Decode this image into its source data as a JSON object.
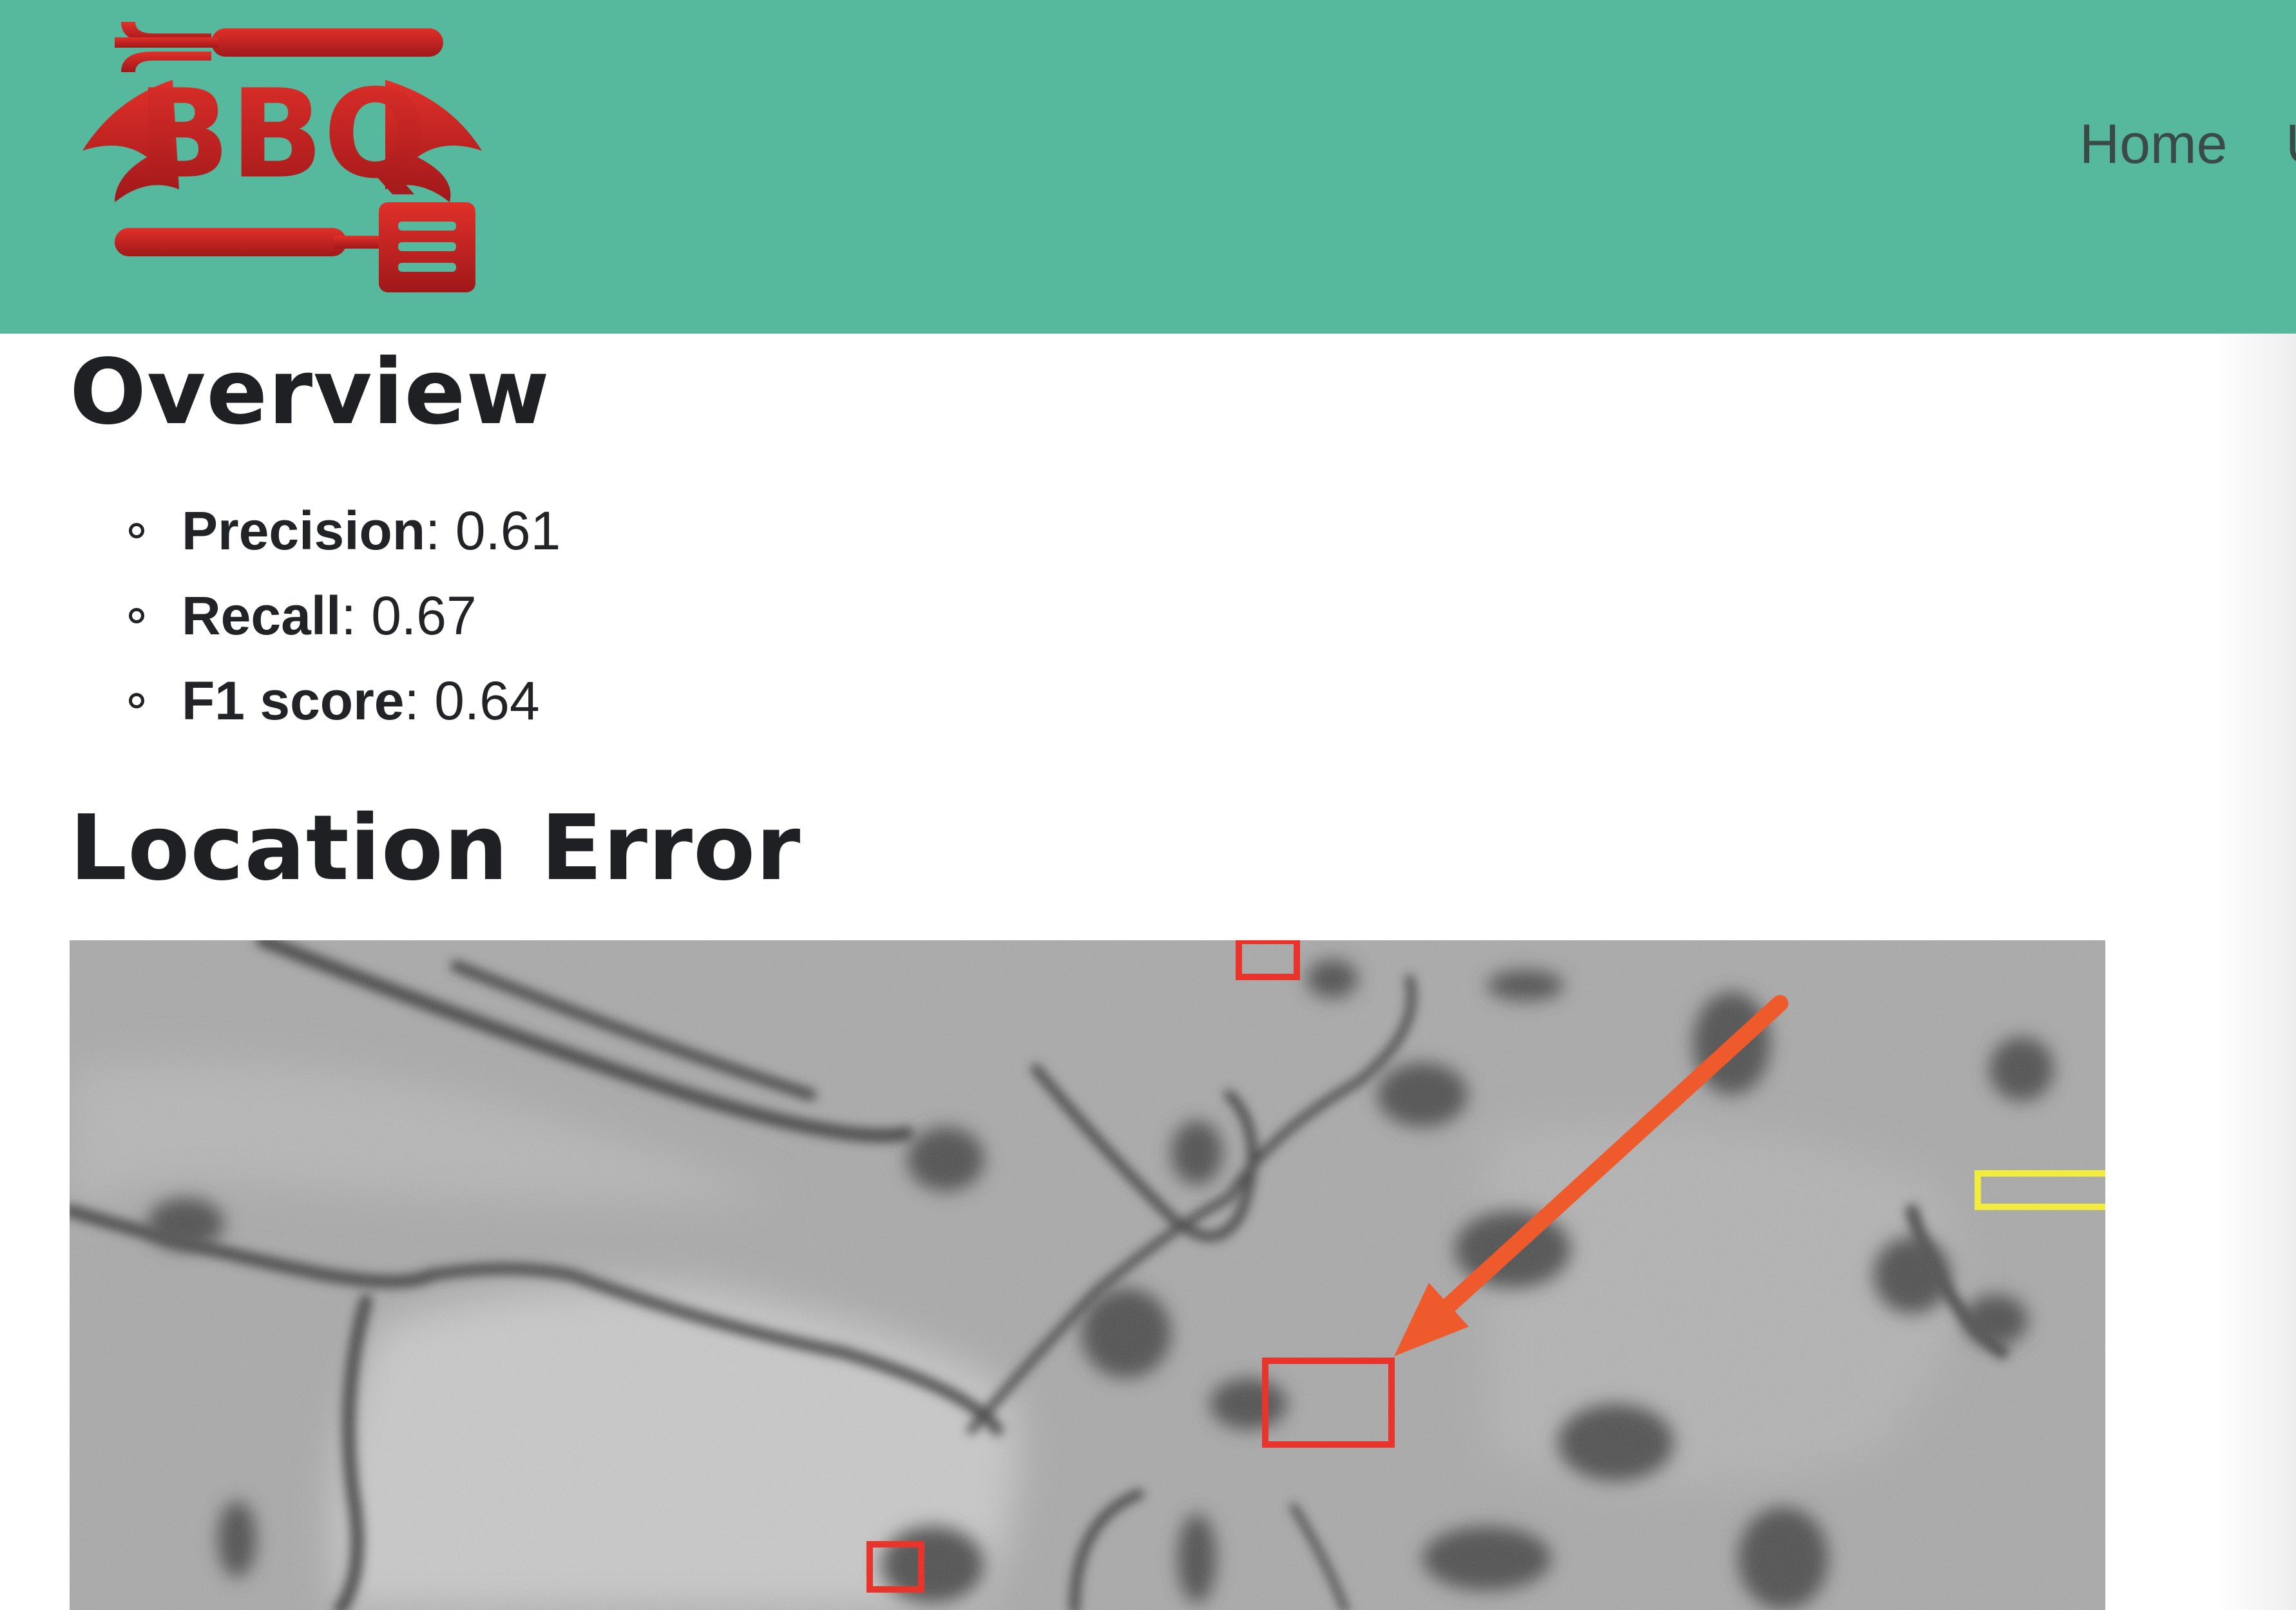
{
  "header": {
    "logo": {
      "text": "BBQ",
      "icon": "bbq-fork-spatula-logo"
    },
    "nav": {
      "home_label": "Home",
      "next_label": "U"
    }
  },
  "overview": {
    "title": "Overview",
    "metrics": [
      {
        "label": "Precision",
        "separator": ":",
        "value": "0.61"
      },
      {
        "label": "Recall",
        "separator": ":",
        "value": "0.67"
      },
      {
        "label": "F1 score",
        "separator": ":",
        "value": "0.64"
      }
    ]
  },
  "location_error": {
    "title": "Location Error",
    "image": {
      "description_icon": "grayscale-microscopy-image",
      "annotation_colors": {
        "red_box": "#e8342a",
        "yellow_box": "#f2ec3c",
        "blue_box": "#1f3cf0",
        "arrow": "#ee5a2c"
      }
    }
  },
  "colors": {
    "header_bg": "#56b99d",
    "logo_red": "#c8221f",
    "text": "#222326"
  }
}
